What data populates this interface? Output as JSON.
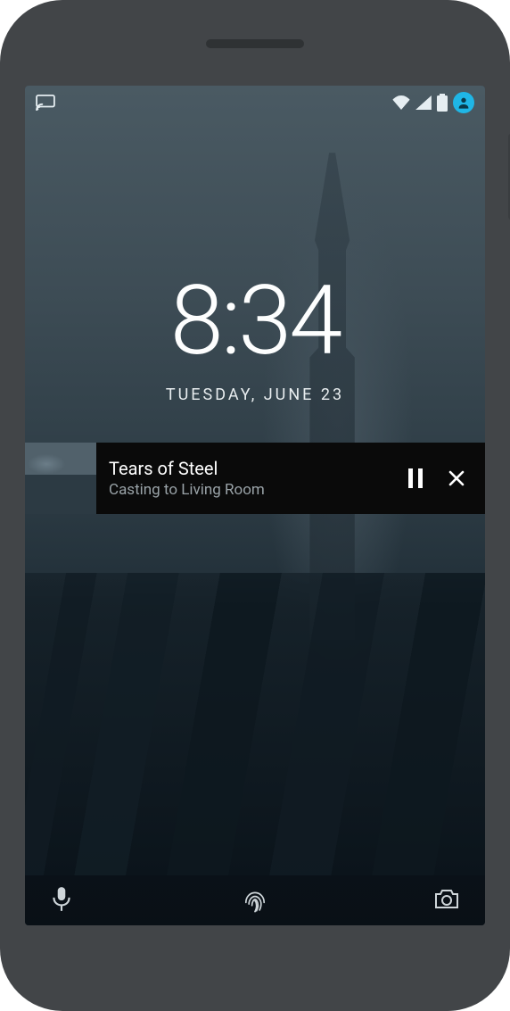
{
  "status": {
    "icons_left": [
      "cast-icon"
    ],
    "icons_right": [
      "wifi-icon",
      "cell-signal-icon",
      "battery-icon",
      "profile-icon"
    ],
    "accent_color": "#1fb6e6"
  },
  "lockscreen": {
    "time": "8:34",
    "date": "TUESDAY, JUNE 23"
  },
  "media": {
    "title": "Tears of Steel",
    "subtitle": "Casting to Living Room",
    "controls": {
      "pause": "pause-icon",
      "close": "close-icon"
    }
  },
  "shortcuts": {
    "left": "voice-assist-icon",
    "center": "fingerprint-icon",
    "right": "camera-icon"
  }
}
